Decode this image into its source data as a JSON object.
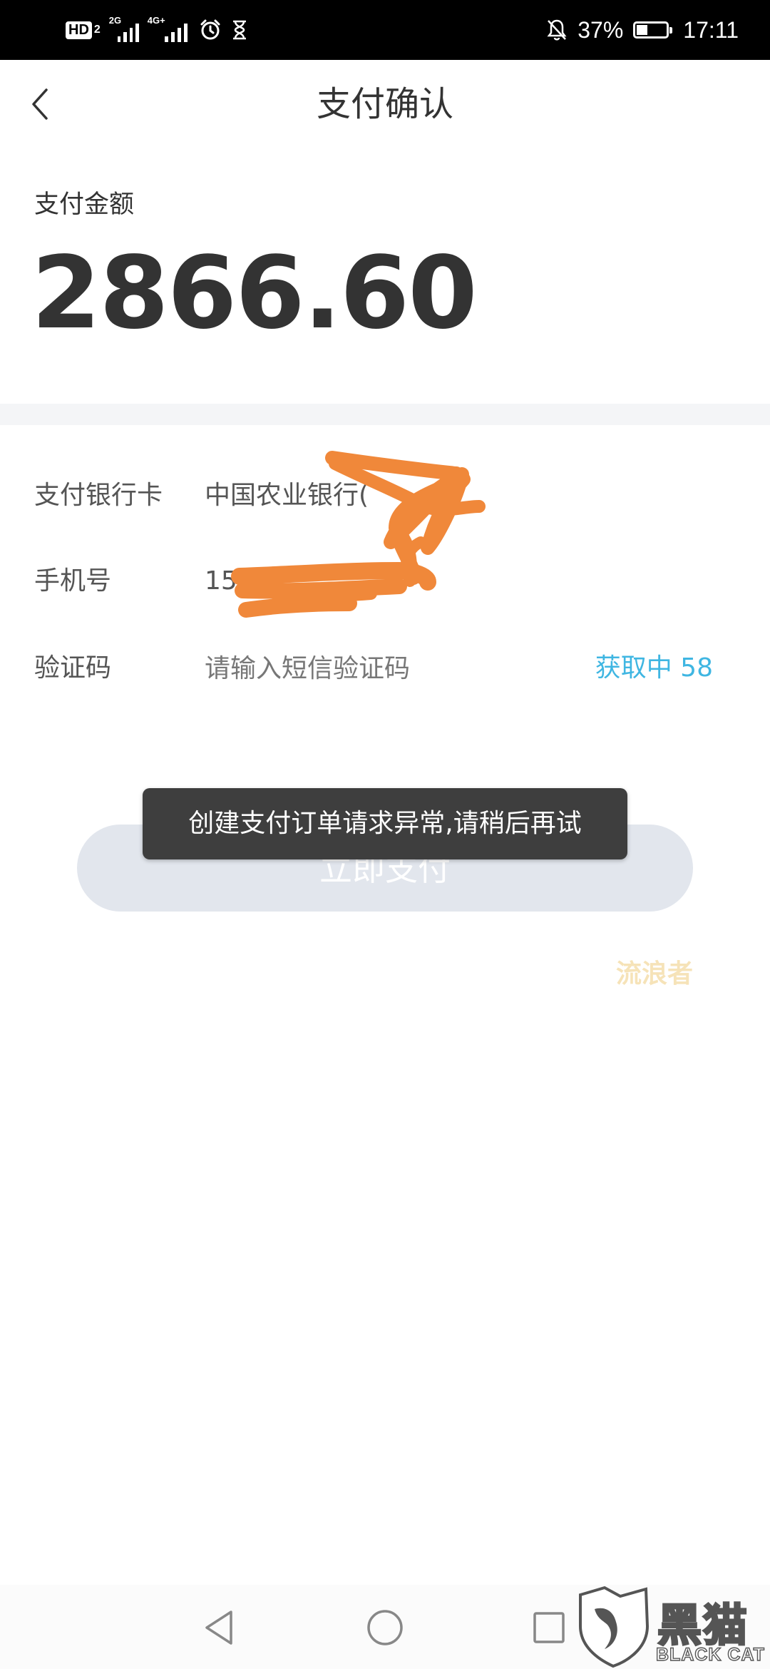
{
  "status_bar": {
    "hd_label": "HD",
    "hd_sub": "2",
    "network_1": "2G",
    "network_2": "4G+",
    "battery_percent": "37%",
    "battery_level": 0.37,
    "time": "17:11"
  },
  "header": {
    "title": "支付确认"
  },
  "amount": {
    "label": "支付金额",
    "value": "2866.60"
  },
  "form": {
    "bank_card": {
      "label": "支付银行卡",
      "value": "中国农业银行("
    },
    "phone": {
      "label": "手机号",
      "value": "15"
    },
    "sms_code": {
      "label": "验证码",
      "placeholder": "请输入短信验证码",
      "countdown": "获取中 58"
    }
  },
  "pay_button": {
    "label": "立即支付"
  },
  "toast": {
    "message": "创建支付订单请求异常,请稍后再试"
  },
  "watermark": {
    "text": "流浪者",
    "brand_cn": "黑猫",
    "brand_en": "BLACK CAT"
  },
  "colors": {
    "accent": "#3fb6e2",
    "scribble": "#f0883a",
    "button_disabled": "#e2e6ed",
    "toast_bg": "#3e3e3e"
  }
}
